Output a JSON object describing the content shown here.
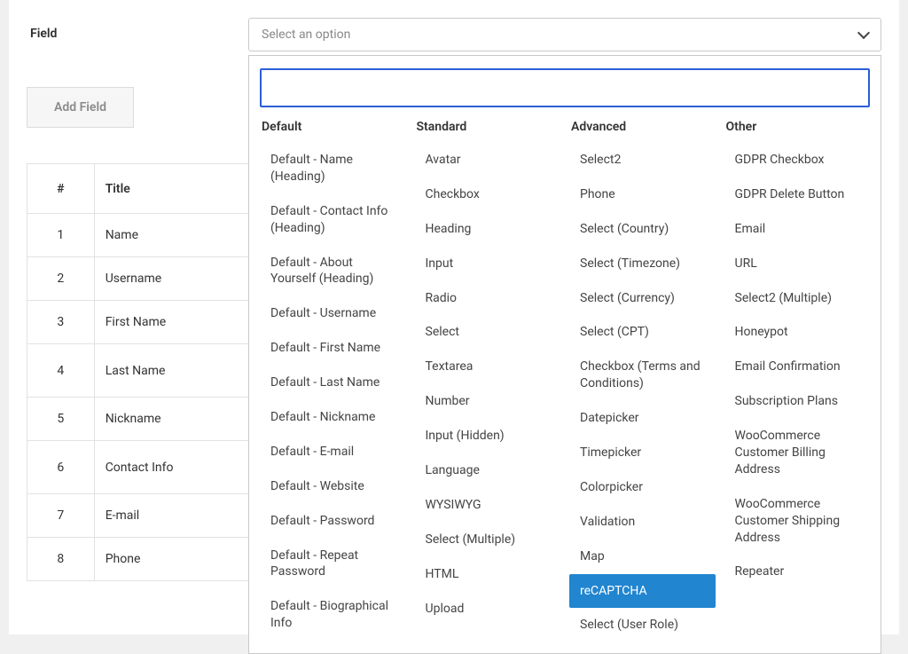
{
  "field_label": "Field",
  "select_placeholder": "Select an option",
  "search_placeholder": "",
  "add_field_label": "Add Field",
  "table": {
    "headers": {
      "num": "#",
      "title": "Title"
    },
    "rows": [
      {
        "num": "1",
        "title": "Name"
      },
      {
        "num": "2",
        "title": "Username"
      },
      {
        "num": "3",
        "title": "First Name"
      },
      {
        "num": "4",
        "title": "Last Name"
      },
      {
        "num": "5",
        "title": "Nickname"
      },
      {
        "num": "6",
        "title": "Contact Info"
      },
      {
        "num": "7",
        "title": "E-mail"
      },
      {
        "num": "8",
        "title": "Phone"
      }
    ]
  },
  "dropdown": {
    "highlighted": "reCAPTCHA",
    "groups": [
      {
        "title": "Default",
        "options": [
          "Default - Name (Heading)",
          "Default - Contact Info (Heading)",
          "Default - About Yourself (Heading)",
          "Default - Username",
          "Default - First Name",
          "Default - Last Name",
          "Default - Nickname",
          "Default - E-mail",
          "Default - Website",
          "Default - Password",
          "Default - Repeat Password",
          "Default - Biographical Info"
        ]
      },
      {
        "title": "Standard",
        "options": [
          "Avatar",
          "Checkbox",
          "Heading",
          "Input",
          "Radio",
          "Select",
          "Textarea",
          "Number",
          "Input (Hidden)",
          "Language",
          "WYSIWYG",
          "Select (Multiple)",
          "HTML",
          "Upload"
        ]
      },
      {
        "title": "Advanced",
        "options": [
          "Select2",
          "Phone",
          "Select (Country)",
          "Select (Timezone)",
          "Select (Currency)",
          "Select (CPT)",
          "Checkbox (Terms and Conditions)",
          "Datepicker",
          "Timepicker",
          "Colorpicker",
          "Validation",
          "Map",
          "reCAPTCHA",
          "Select (User Role)"
        ]
      },
      {
        "title": "Other",
        "options": [
          "GDPR Checkbox",
          "GDPR Delete Button",
          "Email",
          "URL",
          "Select2 (Multiple)",
          "Honeypot",
          "Email Confirmation",
          "Subscription Plans",
          "WooCommerce Customer Billing Address",
          "WooCommerce Customer Shipping Address",
          "Repeater"
        ]
      }
    ]
  }
}
